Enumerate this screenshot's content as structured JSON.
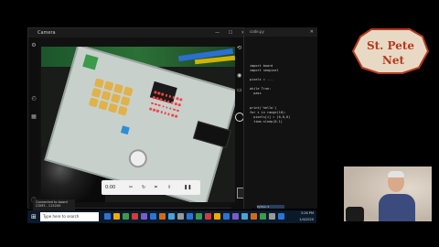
{
  "camera_window": {
    "title": "Camera",
    "controls": "— ☐ ✕",
    "toolbar_time": "0:00",
    "toolbar_icons": [
      "scissors-icon",
      "rotate-icon",
      "crop-icon",
      "share-icon",
      "pause-icon"
    ]
  },
  "editor": {
    "tab_title": "code.py",
    "lines": [
      "import board",
      "import neopixel",
      "",
      "pixels = ...",
      "",
      "while True:",
      "  pass",
      "",
      "",
      "",
      "print('hello')",
      "for i in range(10):",
      "  pixels[i] = (0,0,0)",
      "  time.sleep(0.1)"
    ],
    "status": "Python 3"
  },
  "taskbar": {
    "search_placeholder": "Type here to search",
    "tray_time": "3:26 PM",
    "tray_date": "1/4/2020",
    "icon_colors": [
      "#2b74d6",
      "#f2a900",
      "#3a9b4b",
      "#d13b3b",
      "#7a5cc9",
      "#2b74d6",
      "#d16b1b",
      "#4aa3d6",
      "#999999",
      "#2b74d6",
      "#3a9b4b",
      "#d13b3b",
      "#f2a900",
      "#2b74d6",
      "#7a5cc9",
      "#4aa3d6",
      "#d16b1b",
      "#3a9b4b",
      "#999999",
      "#2b74d6"
    ]
  },
  "notification": {
    "line1": "Connected to board",
    "line2": "COM3 - 115200"
  },
  "logo": {
    "line1": "St. Pete",
    "line2": "Net"
  },
  "colors": {
    "logo_red": "#b33a1f",
    "logo_bg": "#e8d9c4",
    "taskbar": "#0b1a2a"
  }
}
